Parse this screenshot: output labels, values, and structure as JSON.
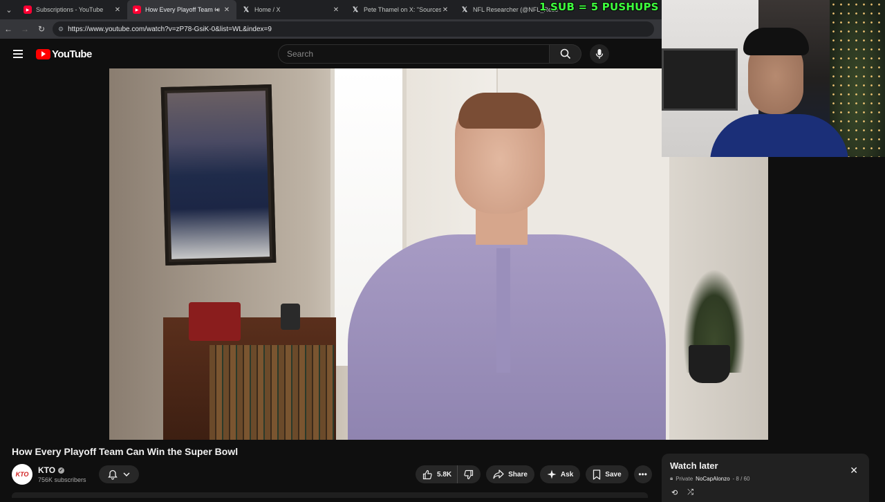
{
  "browser": {
    "tabs": [
      {
        "title": "Subscriptions - YouTube",
        "favicon": "youtube-icon",
        "active": false
      },
      {
        "title": "How Every Playoff Team Ca",
        "favicon": "youtube-icon",
        "active": true
      },
      {
        "title": "Home / X",
        "favicon": "x-icon",
        "active": false
      },
      {
        "title": "Pete Thamel on X: \"Sources: Oh",
        "favicon": "x-icon",
        "active": false
      },
      {
        "title": "NFL Researcher (@NFL_Rese",
        "favicon": "x-icon",
        "active": false
      }
    ],
    "url": "https://www.youtube.com/watch?v=zP78-GsiK-0&list=WL&index=9"
  },
  "youtube": {
    "logo_text": "YouTube",
    "search_placeholder": "Search"
  },
  "stream_overlay": {
    "text": "1 SUB = 5 PUSHUPS",
    "color": "#3dff3d"
  },
  "video": {
    "title": "How Every Playoff Team Can Win the Super Bowl",
    "channel": {
      "name": "KTO",
      "avatar_text": "KTO",
      "subscribers": "756K subscribers"
    },
    "actions": {
      "likes": "5.8K",
      "share": "Share",
      "ask": "Ask",
      "save": "Save"
    }
  },
  "watch_later": {
    "title": "Watch later",
    "privacy": "Private",
    "owner": "NoCapAlonzo",
    "position": "- 8 / 60"
  },
  "colors": {
    "youtube_red": "#ff0000",
    "background": "#0f0f0f"
  }
}
